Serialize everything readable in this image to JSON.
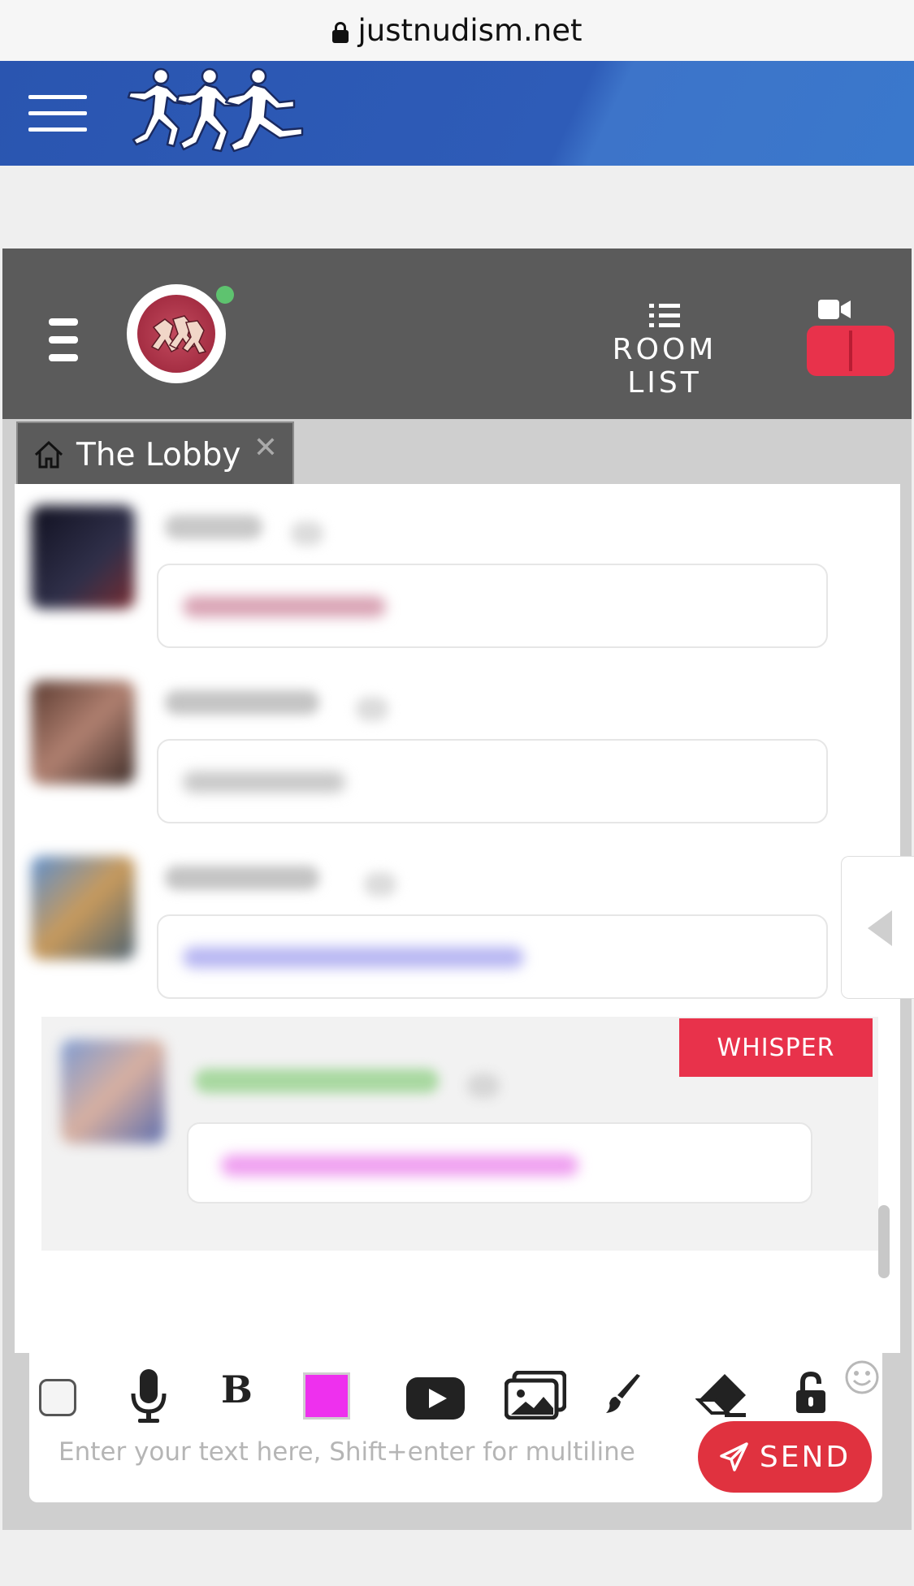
{
  "browser": {
    "url": "justnudism.net"
  },
  "site_header": {
    "logo_alt": "justnudism runners logo"
  },
  "chat": {
    "room_list_label": "ROOM LIST",
    "active_tab": "The Lobby",
    "tab_close_glyph": "✕",
    "whisper_label": "WHISPER",
    "composer": {
      "placeholder": "Enter your text here, Shift+enter for multiline",
      "send_label": "SEND",
      "text_color": "#ee30ee"
    }
  },
  "colors": {
    "site_header_blue": "#2e5cb8",
    "chat_topbar": "#5b5b5b",
    "accent_red": "#e8324b",
    "online_dot": "#5ec36f"
  },
  "icons": [
    "lock-icon",
    "menu-icon",
    "hamburger-icon",
    "list-icon",
    "video-camera-icon",
    "home-icon",
    "close-icon",
    "microphone-icon",
    "bold-icon",
    "youtube-icon",
    "images-icon",
    "brush-icon",
    "eraser-icon",
    "unlock-icon",
    "smiley-icon",
    "send-icon",
    "collapse-arrow-icon"
  ]
}
